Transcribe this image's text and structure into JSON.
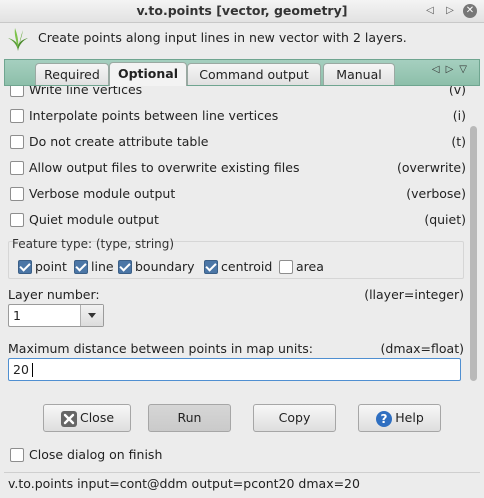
{
  "window": {
    "title": "v.to.points [vector, geometry]"
  },
  "header": {
    "description": "Create points along input lines in new vector with 2 layers."
  },
  "tabs": [
    {
      "label": "Required"
    },
    {
      "label": "Optional"
    },
    {
      "label": "Command output"
    },
    {
      "label": "Manual"
    }
  ],
  "options": [
    {
      "label": "Write line vertices",
      "flag": "(v)",
      "checked": false
    },
    {
      "label": "Interpolate points between line vertices",
      "flag": "(i)",
      "checked": false
    },
    {
      "label": "Do not create attribute table",
      "flag": "(t)",
      "checked": false
    },
    {
      "label": "Allow output files to overwrite existing files",
      "flag": "(overwrite)",
      "checked": false
    },
    {
      "label": "Verbose module output",
      "flag": "(verbose)",
      "checked": false
    },
    {
      "label": "Quiet module output",
      "flag": "(quiet)",
      "checked": false
    }
  ],
  "feature_type": {
    "title": "Feature type: (type, string)",
    "items": [
      {
        "label": "point",
        "checked": true
      },
      {
        "label": "line",
        "checked": true
      },
      {
        "label": "boundary",
        "checked": true
      },
      {
        "label": "centroid",
        "checked": true
      },
      {
        "label": "area",
        "checked": false
      }
    ]
  },
  "layer": {
    "label": "Layer number:",
    "flag": "(llayer=integer)",
    "value": "1"
  },
  "dmax": {
    "label": "Maximum distance between points in map units:",
    "flag": "(dmax=float)",
    "value": "20"
  },
  "buttons": {
    "close": "Close",
    "run": "Run",
    "copy": "Copy",
    "help": "Help"
  },
  "close_on_finish": {
    "label": "Close dialog on finish",
    "checked": false
  },
  "status": {
    "command": "v.to.points input=cont@ddm output=pcont20 dmax=20"
  },
  "colors": {
    "tab_bar": "#8dbfaa",
    "checkbox_checked": "#4b76a6",
    "input_focus": "#4f8fd1"
  }
}
